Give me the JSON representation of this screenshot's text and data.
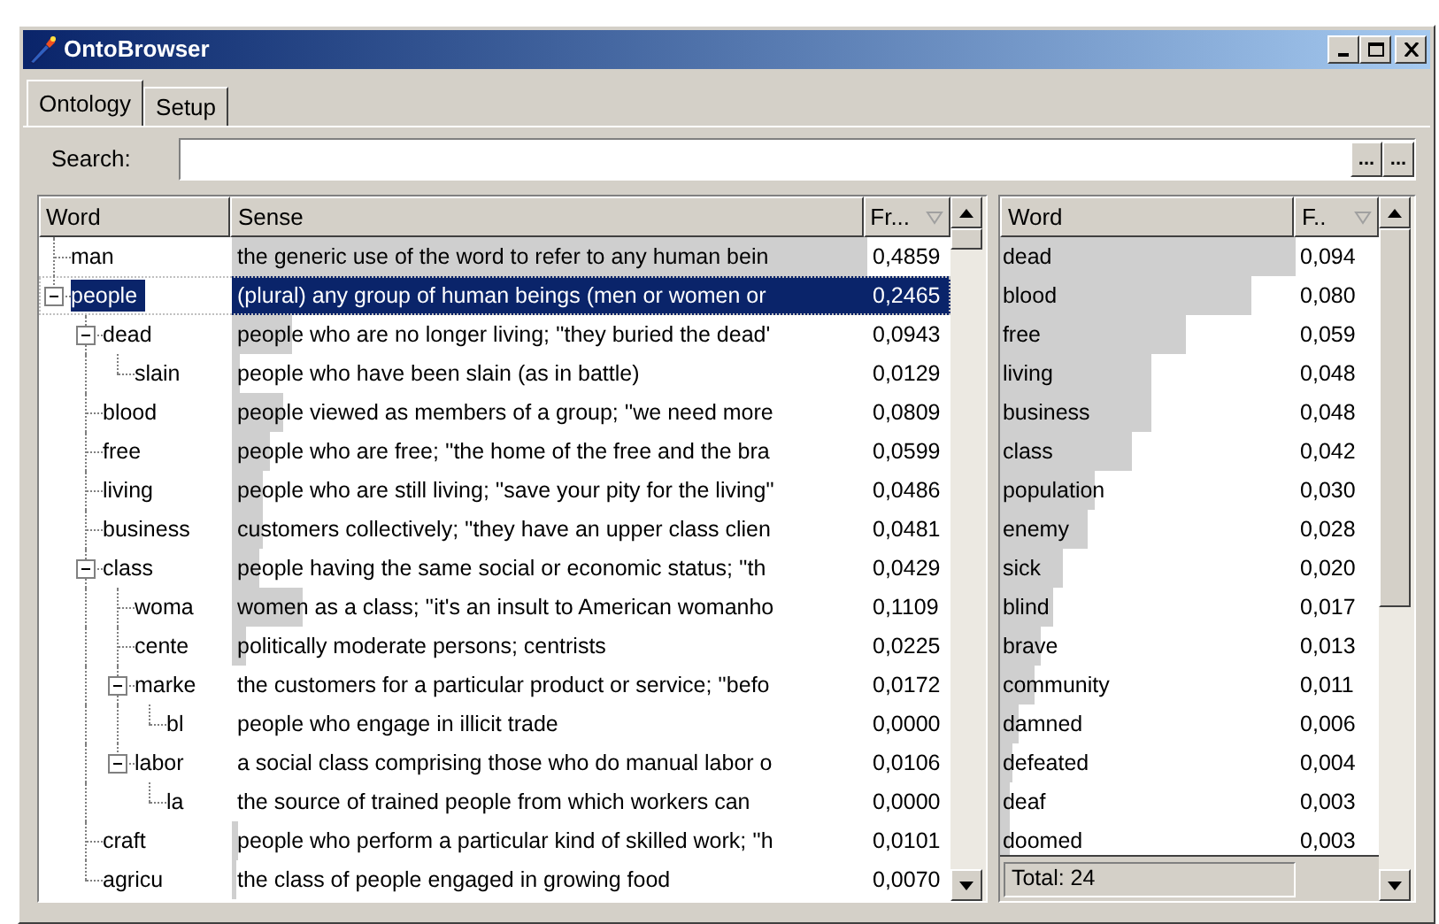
{
  "window": {
    "title": "OntoBrowser"
  },
  "tabs": [
    {
      "label": "Ontology",
      "selected": true
    },
    {
      "label": "Setup",
      "selected": false
    }
  ],
  "search": {
    "label": "Search:",
    "buttons": [
      "...",
      "..."
    ]
  },
  "senses_table": {
    "columns": [
      "Word",
      "Sense",
      "Fr..."
    ],
    "rows": [
      {
        "word": "man",
        "sense": "the generic use of the word to refer to any human bein",
        "freq": "0,4859",
        "selected": false
      },
      {
        "word": "people",
        "sense": "(plural) any group of human beings (men or women or",
        "freq": "0,2465",
        "selected": true,
        "expanded": true,
        "children": [
          {
            "word": "dead",
            "sense": "people who are no longer living; ''they buried the dead'",
            "freq": "0,0943",
            "selected": false,
            "expanded": true,
            "children": [
              {
                "word": "slain",
                "sense": "people who have been slain (as in battle)",
                "freq": "0,0129",
                "selected": false
              }
            ]
          },
          {
            "word": "blood",
            "sense": "people viewed as members of a group; ''we need more",
            "freq": "0,0809",
            "selected": false
          },
          {
            "word": "free",
            "sense": "people who are free; ''the home of the free and the bra",
            "freq": "0,0599",
            "selected": false
          },
          {
            "word": "living",
            "sense": "people who are still living; ''save your pity for the living''",
            "freq": "0,0486",
            "selected": false
          },
          {
            "word": "business",
            "sense": "customers collectively; ''they have an upper class clien",
            "freq": "0,0481",
            "selected": false
          },
          {
            "word": "class",
            "sense": "people having the same social or economic status; ''th",
            "freq": "0,0429",
            "selected": false,
            "expanded": true,
            "children": [
              {
                "word": "woma",
                "sense": "women as a class; ''it's an insult to American womanho",
                "freq": "0,1109",
                "selected": false
              },
              {
                "word": "cente",
                "sense": "politically moderate persons; centrists",
                "freq": "0,0225",
                "selected": false
              },
              {
                "word": "marke",
                "sense": "the customers for a particular product or service; ''befo",
                "freq": "0,0172",
                "selected": false,
                "expanded": true,
                "children": [
                  {
                    "word": "bl",
                    "sense": "people who engage in illicit trade",
                    "freq": "0,0000",
                    "selected": false
                  }
                ]
              },
              {
                "word": "labor",
                "sense": "a social class comprising those who do manual labor o",
                "freq": "0,0106",
                "selected": false,
                "expanded": true,
                "children": [
                  {
                    "word": "la",
                    "sense": "the source of trained people from which workers can",
                    "freq": "0,0000",
                    "selected": false
                  }
                ]
              }
            ]
          },
          {
            "word": "craft",
            "sense": "people who perform a particular kind of skilled work; ''h",
            "freq": "0,0101",
            "selected": false
          },
          {
            "word": "agricu",
            "sense": "the class of people engaged in growing food",
            "freq": "0,0070",
            "selected": false
          }
        ]
      }
    ]
  },
  "words_table": {
    "columns": [
      "Word",
      "F.."
    ],
    "rows": [
      {
        "word": "dead",
        "freq": "0,094"
      },
      {
        "word": "blood",
        "freq": "0,080"
      },
      {
        "word": "free",
        "freq": "0,059"
      },
      {
        "word": "living",
        "freq": "0,048"
      },
      {
        "word": "business",
        "freq": "0,048"
      },
      {
        "word": "class",
        "freq": "0,042"
      },
      {
        "word": "population",
        "freq": "0,030"
      },
      {
        "word": "enemy",
        "freq": "0,028"
      },
      {
        "word": "sick",
        "freq": "0,020"
      },
      {
        "word": "blind",
        "freq": "0,017"
      },
      {
        "word": "brave",
        "freq": "0,013"
      },
      {
        "word": "community",
        "freq": "0,011"
      },
      {
        "word": "damned",
        "freq": "0,006"
      },
      {
        "word": "defeated",
        "freq": "0,004"
      },
      {
        "word": "deaf",
        "freq": "0,003"
      },
      {
        "word": "doomed",
        "freq": "0,003"
      }
    ],
    "total": "Total: 24"
  }
}
